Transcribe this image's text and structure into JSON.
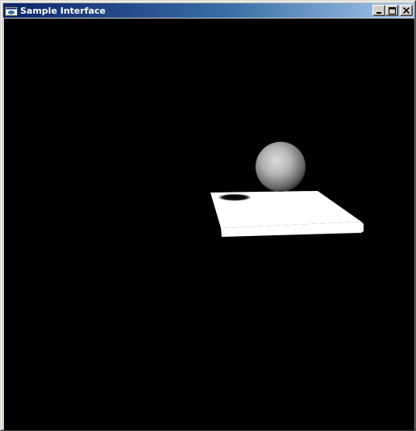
{
  "window": {
    "title": "Sample Interface",
    "icon": "app-window-icon",
    "controls": {
      "minimize_icon": "minimize-icon",
      "maximize_icon": "maximize-icon",
      "close_icon": "close-icon"
    },
    "colors": {
      "titlebar_start": "#0a246a",
      "titlebar_end": "#a6caf0",
      "client_background": "#000000"
    }
  },
  "scene": {
    "objects": [
      "sphere",
      "box",
      "shadow"
    ],
    "colors": {
      "box": "#ffffff",
      "sphere_highlight": "#d8d8d8",
      "sphere_shadow": "#3c3c3c",
      "shadow": "#1a1a1a"
    }
  }
}
